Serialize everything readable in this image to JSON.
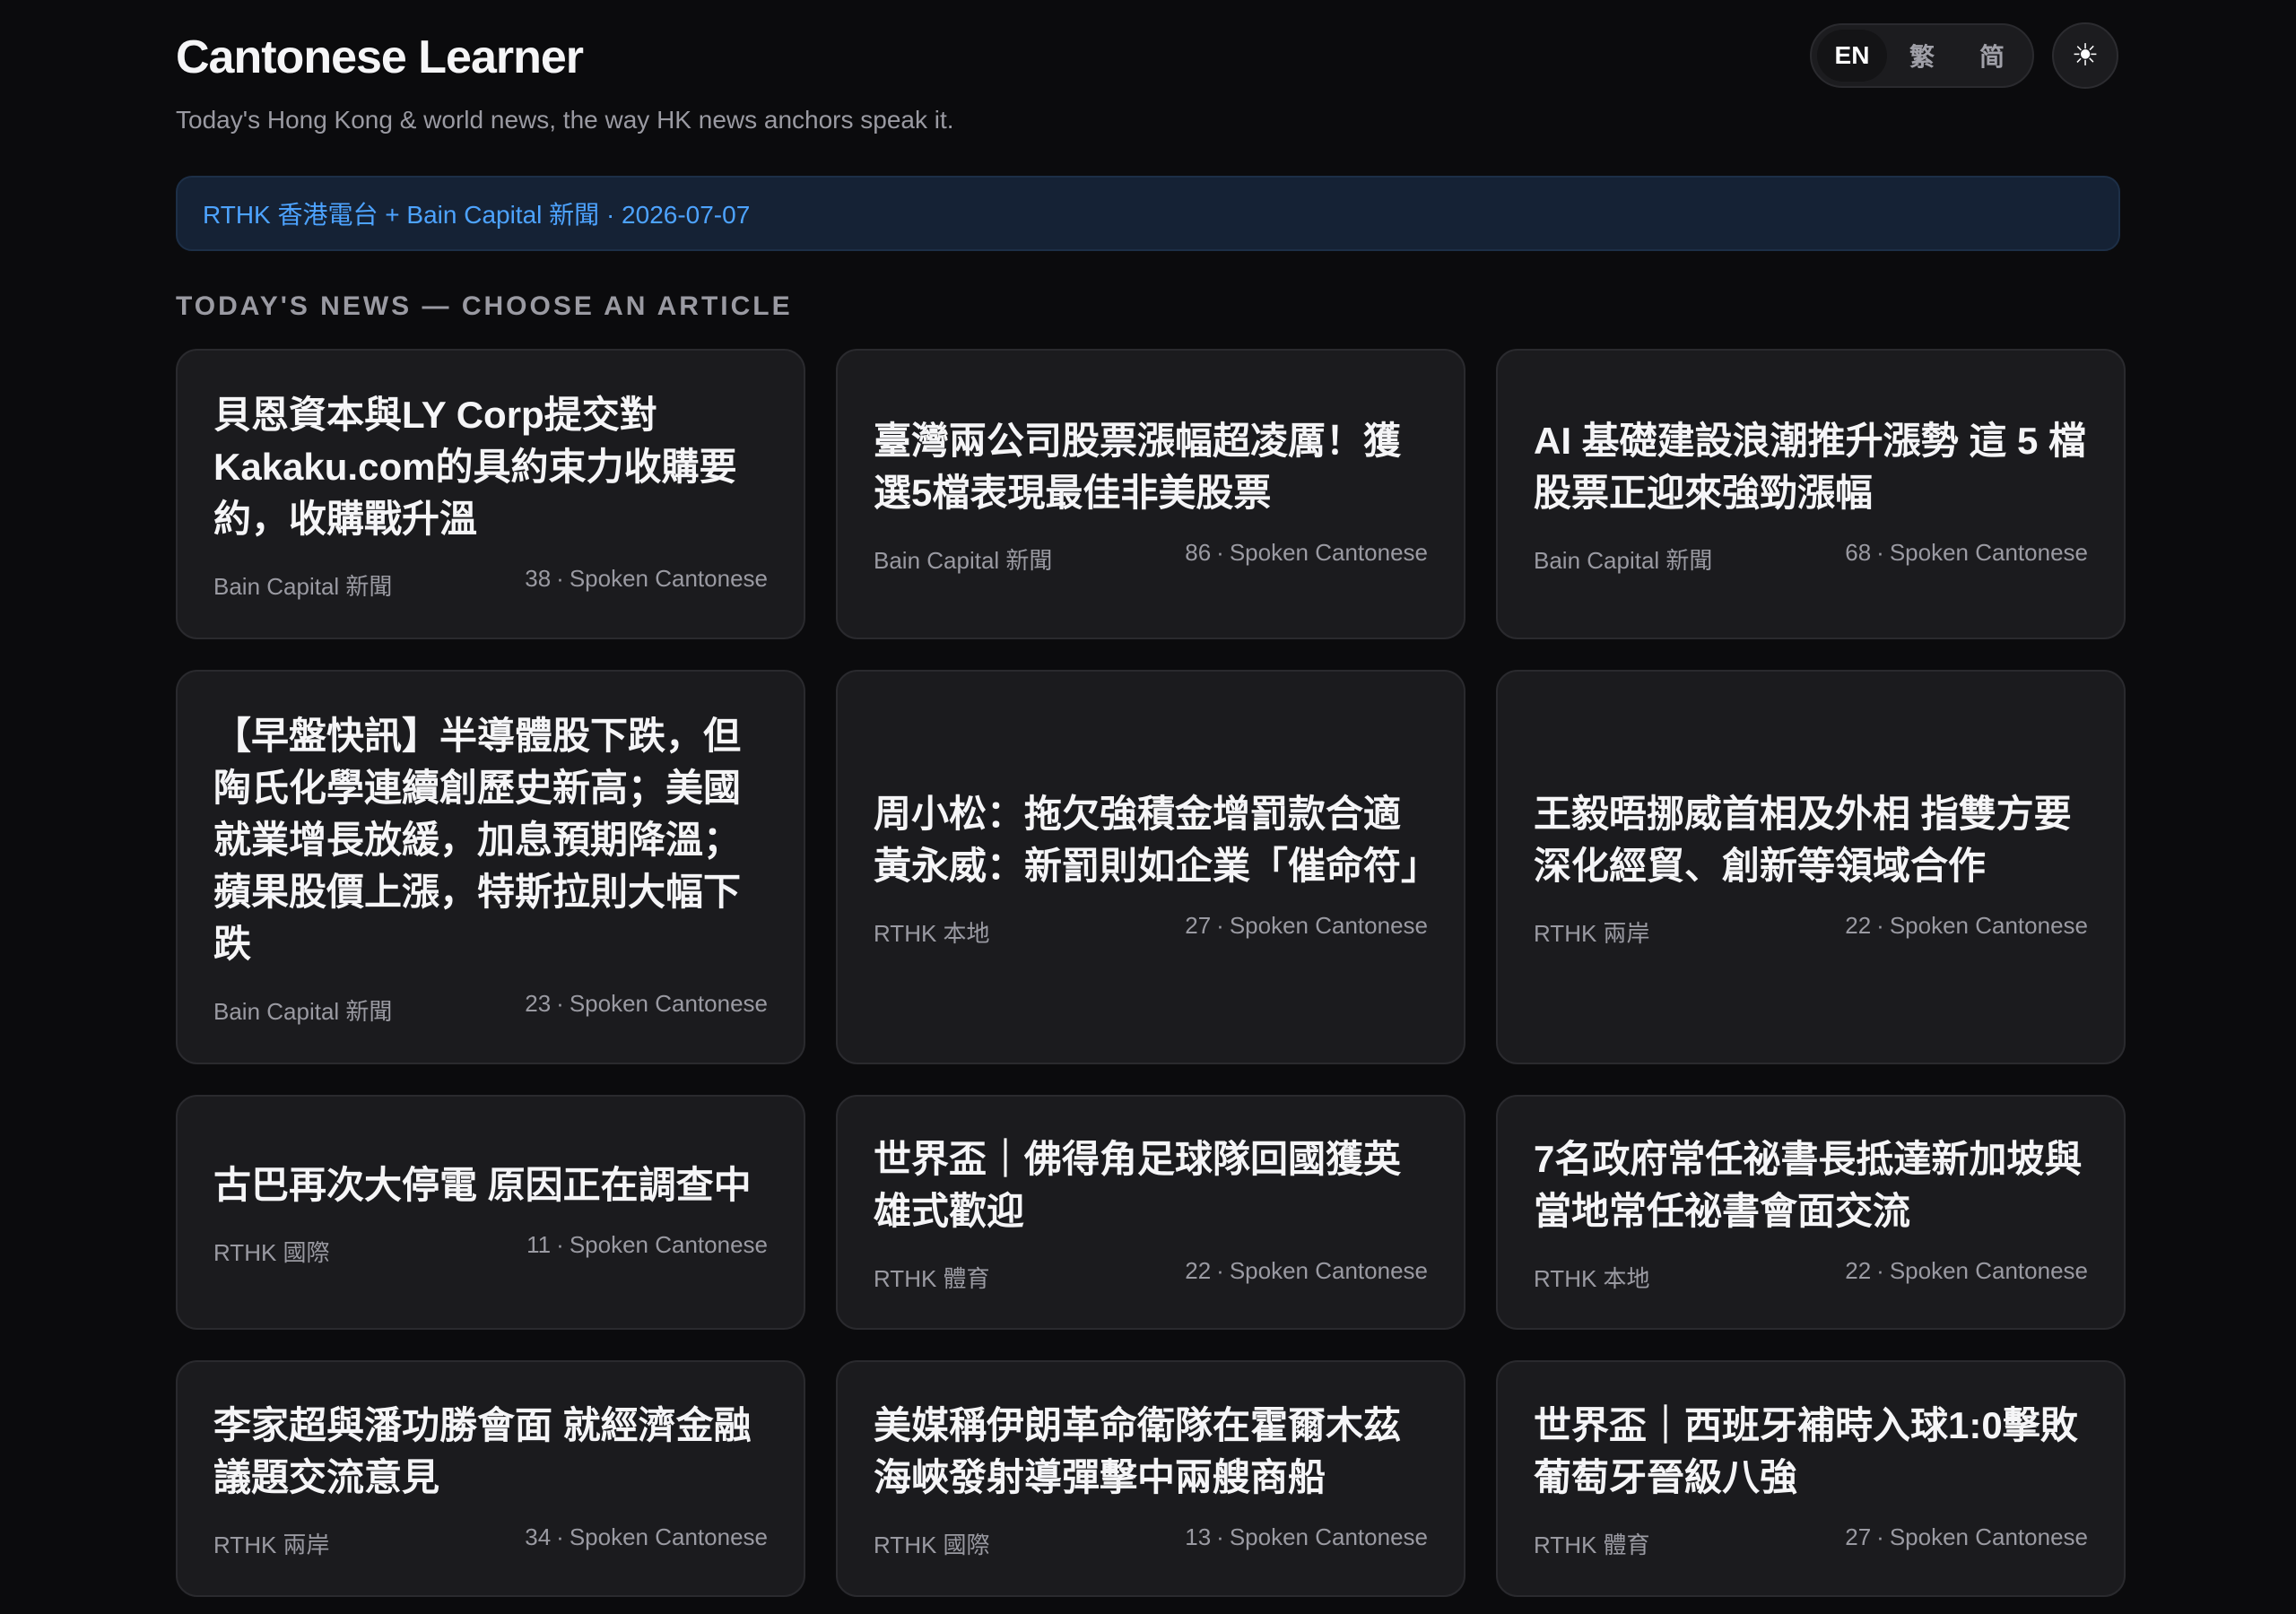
{
  "header": {
    "title": "Cantonese Learner",
    "subtitle": "Today's Hong Kong & world news, the way HK news anchors speak it."
  },
  "lang_switch": {
    "options": [
      "EN",
      "繁",
      "简"
    ],
    "active": "EN"
  },
  "theme_toggle": {
    "icon": "sun-icon",
    "glyph": "☀"
  },
  "banner": {
    "text": "RTHK 香港電台 + Bain Capital 新聞 · 2026-07-07"
  },
  "section_label": "TODAY'S NEWS — CHOOSE AN ARTICLE",
  "articles": [
    {
      "title": "貝恩資本與LY Corp提交對Kakaku.com的具約束力收購要約，收購戰升溫",
      "source": "Bain Capital 新聞",
      "count": "38",
      "mode": "Spoken Cantonese"
    },
    {
      "title": "臺灣兩公司股票漲幅超凌厲！獲選5檔表現最佳非美股票",
      "source": "Bain Capital 新聞",
      "count": "86",
      "mode": "Spoken Cantonese"
    },
    {
      "title": "AI 基礎建設浪潮推升漲勢 這 5 檔股票正迎來強勁漲幅",
      "source": "Bain Capital 新聞",
      "count": "68",
      "mode": "Spoken Cantonese"
    },
    {
      "title": "【早盤快訊】半導體股下跌，但陶氏化學連續創歷史新高；美國就業增長放緩，加息預期降溫；蘋果股價上漲，特斯拉則大幅下跌",
      "source": "Bain Capital 新聞",
      "count": "23",
      "mode": "Spoken Cantonese"
    },
    {
      "title": "周小松：拖欠強積金增罰款合適 黃永威：新罰則如企業「催命符」",
      "source": "RTHK 本地",
      "count": "27",
      "mode": "Spoken Cantonese"
    },
    {
      "title": "王毅晤挪威首相及外相 指雙方要深化經貿、創新等領域合作",
      "source": "RTHK 兩岸",
      "count": "22",
      "mode": "Spoken Cantonese"
    },
    {
      "title": "古巴再次大停電 原因正在調查中",
      "source": "RTHK 國際",
      "count": "11",
      "mode": "Spoken Cantonese"
    },
    {
      "title": "世界盃｜佛得角足球隊回國獲英雄式歡迎",
      "source": "RTHK 體育",
      "count": "22",
      "mode": "Spoken Cantonese"
    },
    {
      "title": "7名政府常任祕書長抵達新加坡與當地常任祕書會面交流",
      "source": "RTHK 本地",
      "count": "22",
      "mode": "Spoken Cantonese"
    },
    {
      "title": "李家超與潘功勝會面 就經濟金融議題交流意見",
      "source": "RTHK 兩岸",
      "count": "34",
      "mode": "Spoken Cantonese"
    },
    {
      "title": "美媒稱伊朗革命衛隊在霍爾木茲海峽發射導彈擊中兩艘商船",
      "source": "RTHK 國際",
      "count": "13",
      "mode": "Spoken Cantonese"
    },
    {
      "title": "世界盃｜西班牙補時入球1:0擊敗葡萄牙晉級八強",
      "source": "RTHK 體育",
      "count": "27",
      "mode": "Spoken Cantonese"
    }
  ]
}
